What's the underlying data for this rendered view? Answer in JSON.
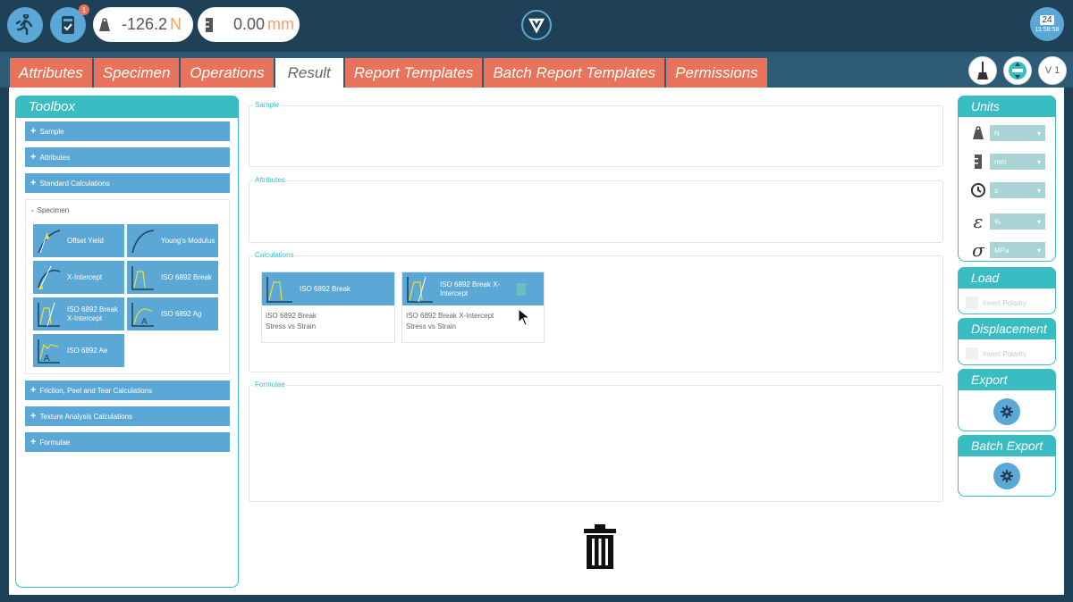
{
  "header": {
    "force": {
      "value": "-126.2",
      "unit": "N"
    },
    "position": {
      "value": "0.00",
      "unit": "mm"
    },
    "notification_count": "1",
    "clock": {
      "day": "24",
      "time": "11:58:58"
    }
  },
  "tabs": [
    {
      "label": "Attributes",
      "active": false
    },
    {
      "label": "Specimen",
      "active": false
    },
    {
      "label": "Operations",
      "active": false
    },
    {
      "label": "Result",
      "active": true
    },
    {
      "label": "Report Templates",
      "active": false
    },
    {
      "label": "Batch Report Templates",
      "active": false
    },
    {
      "label": "Permissions",
      "active": false
    }
  ],
  "toolbar_right": {
    "version": "V 1"
  },
  "toolbox": {
    "title": "Toolbox",
    "sections": [
      "Sample",
      "Attributes",
      "Standard Calculations",
      "Specimen",
      "Friction, Peel and Tear Calculations",
      "Texture Analysis Calculations",
      "Formulae"
    ],
    "specimen_items": [
      "Offset Yield",
      "Young's Modulus",
      "X-Intercept",
      "ISO 6892 Break",
      "ISO 6892 Break X-Intercept",
      "ISO 6892 Ag",
      "ISO 6892 Ae"
    ]
  },
  "center": {
    "legends": {
      "sample": "Sample",
      "attributes": "Attributes",
      "calculations": "Calculations",
      "formulae": "Formulae"
    },
    "cards": [
      {
        "title": "ISO 6892 Break",
        "line1": "ISO 6892 Break",
        "line2": "Stress vs Strain"
      },
      {
        "title": "ISO 6892 Break X-Intercept",
        "line1": "ISO 6892 Break X-Intercept",
        "line2": "Stress vs Strain"
      }
    ]
  },
  "units_panel": {
    "title": "Units",
    "rows": [
      {
        "icon": "weight-icon",
        "value": "N"
      },
      {
        "icon": "ruler-icon",
        "value": "mm"
      },
      {
        "icon": "clock-icon",
        "value": "s"
      },
      {
        "icon": "epsilon-icon",
        "symbol": "ε",
        "value": "%"
      },
      {
        "icon": "sigma-icon",
        "symbol": "σ",
        "value": "MPa"
      }
    ]
  },
  "load_panel": {
    "title": "Load",
    "checkbox_label": "Invert Polarity"
  },
  "displacement_panel": {
    "title": "Displacement",
    "checkbox_label": "Invert Polarity"
  },
  "export_panel": {
    "title": "Export"
  },
  "batch_export_panel": {
    "title": "Batch Export"
  },
  "colors": {
    "accent_teal": "#39bdc2",
    "tab_orange": "#e8735a",
    "button_blue": "#5ba8d6",
    "header_navy": "#1f4158"
  }
}
